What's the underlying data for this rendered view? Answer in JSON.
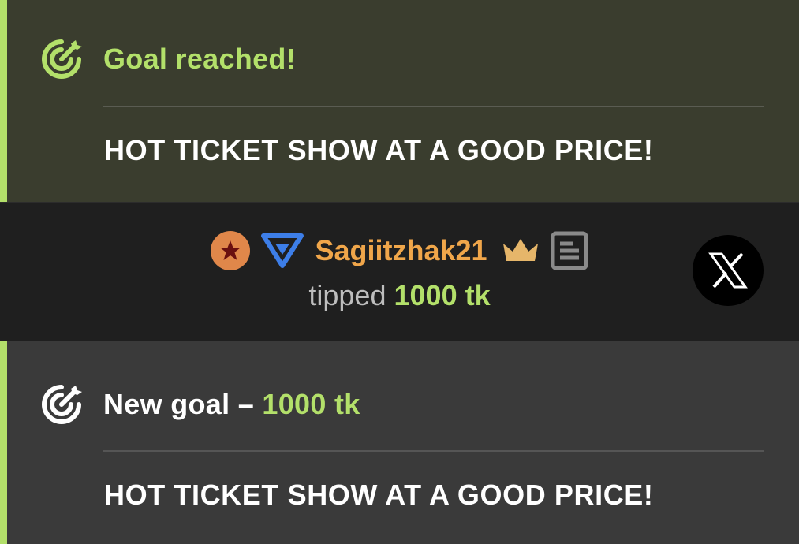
{
  "colors": {
    "accent_green": "#b3e06a",
    "username_orange": "#f0a64a",
    "star_badge": "#e0874a",
    "triangle_badge": "#3d7ee8",
    "crown_gold": "#e6b66a"
  },
  "goal_reached": {
    "icon": "target-icon",
    "title": "Goal reached!",
    "description": "HOT TICKET SHOW AT A GOOD PRICE!"
  },
  "tip": {
    "badges": [
      "star-badge-icon",
      "triangle-badge-icon"
    ],
    "username": "Sagiitzhak21",
    "extra_icons": [
      "crown-icon",
      "document-icon"
    ],
    "action_text": "tipped",
    "amount": "1000 tk",
    "share_button": "x-logo-icon"
  },
  "goal_new": {
    "icon": "target-icon",
    "title_prefix": "New goal –",
    "amount": "1000 tk",
    "description": "HOT TICKET SHOW AT A GOOD PRICE!"
  }
}
